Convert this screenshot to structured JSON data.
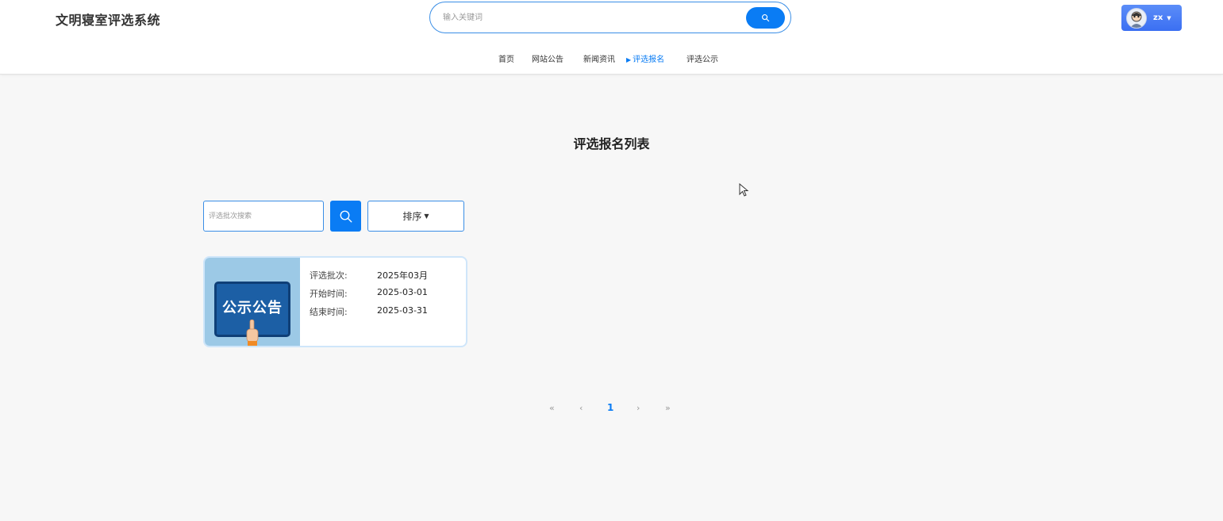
{
  "header": {
    "logo": "文明寝室评选系统",
    "search_placeholder": "输入关键词",
    "user": {
      "name": "zx"
    }
  },
  "nav": {
    "items": [
      {
        "label": "首页",
        "active": false
      },
      {
        "label": "网站公告",
        "active": false
      },
      {
        "label": "新闻资讯",
        "active": false
      },
      {
        "label": "评选报名",
        "active": true
      },
      {
        "label": "评选公示",
        "active": false
      }
    ]
  },
  "main": {
    "title": "评选报名列表",
    "filter": {
      "placeholder": "评选批次搜索",
      "sort_label": "排序"
    },
    "cards": [
      {
        "image_text": "公示公告",
        "fields": [
          {
            "label": "评选批次:",
            "value": "2025年03月"
          },
          {
            "label": "开始时间:",
            "value": "2025-03-01"
          },
          {
            "label": "结束时间:",
            "value": "2025-03-31"
          }
        ]
      }
    ]
  },
  "pagination": {
    "first": "«",
    "prev": "‹",
    "current": "1",
    "next": "›",
    "last": "»"
  },
  "colors": {
    "accent": "#0a7cf4",
    "border": "#3a8ee6",
    "user_button": "#4a7ef5",
    "card_border": "#cfe6fa"
  },
  "icons": [
    "search-icon",
    "chevron-down-icon",
    "caret-right-icon",
    "avatar-icon",
    "pointing-hand-icon",
    "mouse-cursor-icon"
  ]
}
